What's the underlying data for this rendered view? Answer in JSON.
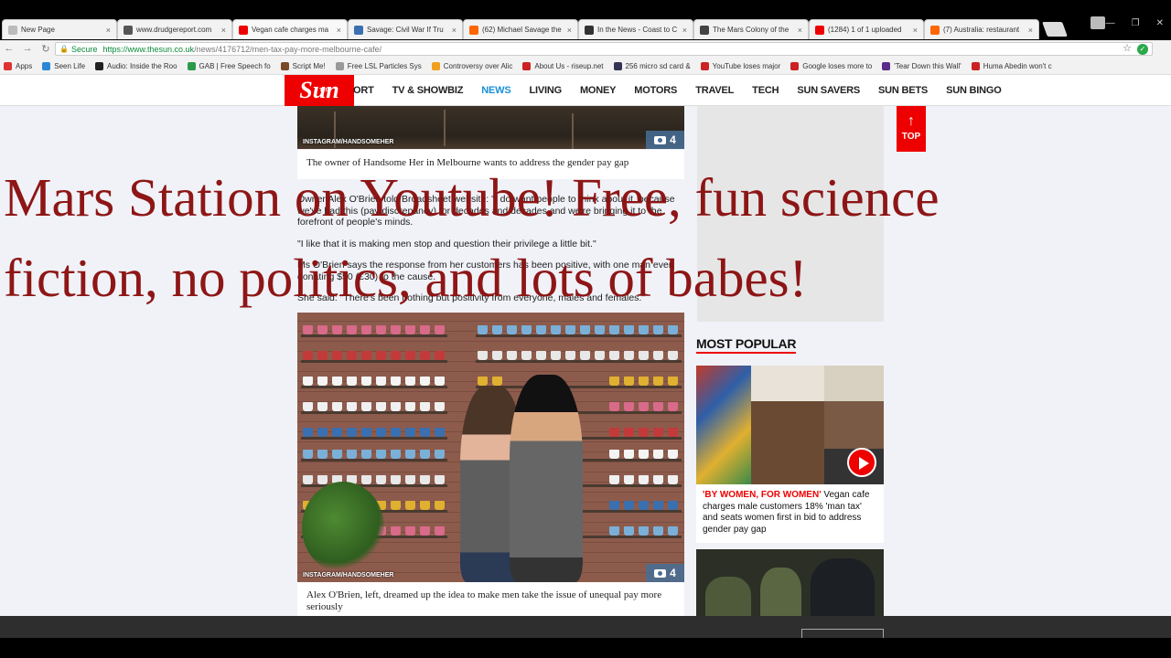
{
  "browser": {
    "tabs": [
      {
        "title": "New Page",
        "fav": "#bbb",
        "active": false
      },
      {
        "title": "www.drudgereport.com",
        "fav": "#555",
        "active": false
      },
      {
        "title": "Vegan cafe charges ma",
        "fav": "#e00",
        "active": true
      },
      {
        "title": "Savage: Civil War If Tru",
        "fav": "#3a6fb0",
        "active": false
      },
      {
        "title": "(62) Michael Savage the",
        "fav": "#f60",
        "active": false
      },
      {
        "title": "In the News - Coast to C",
        "fav": "#333",
        "active": false
      },
      {
        "title": "The Mars Colony of the",
        "fav": "#444",
        "active": false
      },
      {
        "title": "(1284) 1 of 1 uploaded",
        "fav": "#e00",
        "active": false
      },
      {
        "title": "(7) Australia: restaurant",
        "fav": "#f60",
        "active": false
      }
    ],
    "tab_close": "×",
    "secure_label": "Secure",
    "url_host": "https://www.thesun.co.uk",
    "url_path": "/news/4176712/men-tax-pay-more-melbourne-cafe/",
    "bookmarks": [
      {
        "label": "Apps",
        "fav": "#d33"
      },
      {
        "label": "Seen Life",
        "fav": "#2b86d6"
      },
      {
        "label": "Audio: Inside the Roo",
        "fav": "#222"
      },
      {
        "label": "GAB | Free Speech fo",
        "fav": "#2c9a4a"
      },
      {
        "label": "Script Me!",
        "fav": "#7a4a2a"
      },
      {
        "label": "Free LSL Particles Sys",
        "fav": "#999"
      },
      {
        "label": "Controversy over Alic",
        "fav": "#f0a020"
      },
      {
        "label": "About Us - riseup.net",
        "fav": "#c22"
      },
      {
        "label": "256 micro sd card &",
        "fav": "#335"
      },
      {
        "label": "YouTube loses major",
        "fav": "#c22"
      },
      {
        "label": "Google loses more to",
        "fav": "#c22"
      },
      {
        "label": "'Tear Down this Wall'",
        "fav": "#5b2a8a"
      },
      {
        "label": "Huma Abedin won't c",
        "fav": "#c22"
      }
    ]
  },
  "site": {
    "logo": "Sun",
    "logo_small": "THE",
    "nav": [
      {
        "label": "ORT",
        "active": false
      },
      {
        "label": "TV & SHOWBIZ",
        "active": false
      },
      {
        "label": "NEWS",
        "active": true
      },
      {
        "label": "LIVING",
        "active": false
      },
      {
        "label": "MONEY",
        "active": false
      },
      {
        "label": "MOTORS",
        "active": false
      },
      {
        "label": "TRAVEL",
        "active": false
      },
      {
        "label": "TECH",
        "active": false
      },
      {
        "label": "SUN SAVERS",
        "active": false
      },
      {
        "label": "SUN BETS",
        "active": false
      },
      {
        "label": "SUN BINGO",
        "active": false
      }
    ]
  },
  "article": {
    "photo1_credit": "INSTAGRAM/HANDSOMEHER",
    "photo1_count": "4",
    "caption1": "The owner of Handsome Her in Melbourne wants to address the gender pay gap",
    "p1": "Owner Alex O'Brien told Broadsheet website: \"I do want people to think about it, because we've had this (pay discrepancy) for decades and decades and we're bringing it to the forefront of people's minds.",
    "p2": "\"I like that it is making men stop and question their privilege a little bit.\"",
    "p3": "Ms O'Brien says the response from her customers has been positive, with one man even donating $50 (£30) to the cause.",
    "p4": "She said: \"There's been nothing but positivity from everyone, males and females.\"",
    "photo2_credit": "INSTAGRAM/HANDSOMEHER",
    "photo2_count": "4",
    "caption2": "Alex O'Brien, left, dreamed up the idea to make men take the issue of unequal pay more seriously"
  },
  "sidebar": {
    "top_label": "TOP",
    "most_popular": "MOST POPULAR",
    "card1_kicker": "'BY WOMEN, FOR WOMEN'",
    "card1_title": "Vegan cafe charges male customers 18% 'man tax' and seats women first in bid to address gender pay gap"
  },
  "overlay": {
    "line1": "Mars Station on Youtube! Free, fun science",
    "line2": "fiction, no politics, and lots of babes!"
  },
  "colors": {
    "sun_red": "#e00",
    "overlay_text": "#8b0f0f",
    "news_blue": "#1a8fd8"
  }
}
